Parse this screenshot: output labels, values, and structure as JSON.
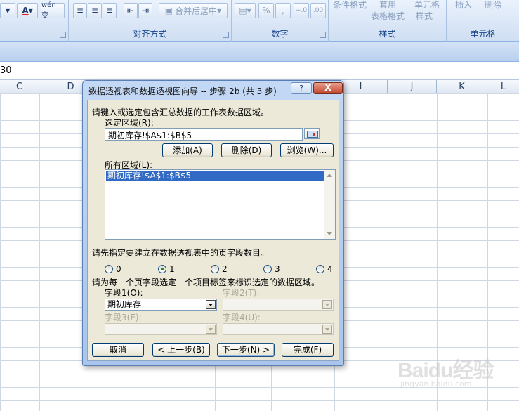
{
  "ribbon": {
    "font_group": {
      "font_color_glyph": "A",
      "wen_btn": "wén 变"
    },
    "align_group": {
      "label": "对齐方式",
      "merge_label": "合并后居中"
    },
    "number_group": {
      "label": "数字",
      "percent": "%",
      "comma": ",",
      "inc_decimal": "+.0",
      "dec_decimal": ".00"
    },
    "styles_group": {
      "label": "样式",
      "cond_format": "条件格式",
      "table_format_1": "套用",
      "table_format_2": "表格格式",
      "cell_style_1": "单元格",
      "cell_style_2": "样式"
    },
    "cells_group": {
      "label": "单元格",
      "insert": "插入",
      "delete": "删除"
    }
  },
  "formula_bar": {
    "value": "30"
  },
  "columns": [
    "C",
    "D",
    "E",
    "F",
    "G",
    "H",
    "I",
    "J",
    "K",
    "L"
  ],
  "dialog": {
    "title": "数据透视表和数据透视图向导 -- 步骤 2b (共 3 步)",
    "help": "?",
    "close": "X",
    "instruction": "请键入或选定包含汇总数据的工作表数据区域。",
    "range_label": "选定区域(R):",
    "range_value": "期初库存!$A$1:$B$5",
    "add_btn": "添加(A)",
    "delete_btn": "删除(D)",
    "browse_btn": "浏览(W)...",
    "all_ranges_label": "所有区域(L):",
    "all_ranges": [
      "期初库存!$A$1:$B$5"
    ],
    "page_field_prompt": "请先指定要建立在数据透视表中的页字段数目。",
    "page_field_options": [
      "0",
      "1",
      "2",
      "3",
      "4"
    ],
    "page_field_selected": "1",
    "item_label_prompt": "请为每一个页字段选定一个项目标签来标识选定的数据区域。",
    "field1_label": "字段1(O):",
    "field1_value": "期初库存",
    "field2_label": "字段2(T):",
    "field3_label": "字段3(E):",
    "field4_label": "字段4(U):",
    "cancel_btn": "取消",
    "back_btn": "< 上一步(B)",
    "next_btn": "下一步(N) >",
    "finish_btn": "完成(F)"
  },
  "watermark": {
    "logo": "Baidu经验",
    "url": "jingyan.baidu.com"
  }
}
